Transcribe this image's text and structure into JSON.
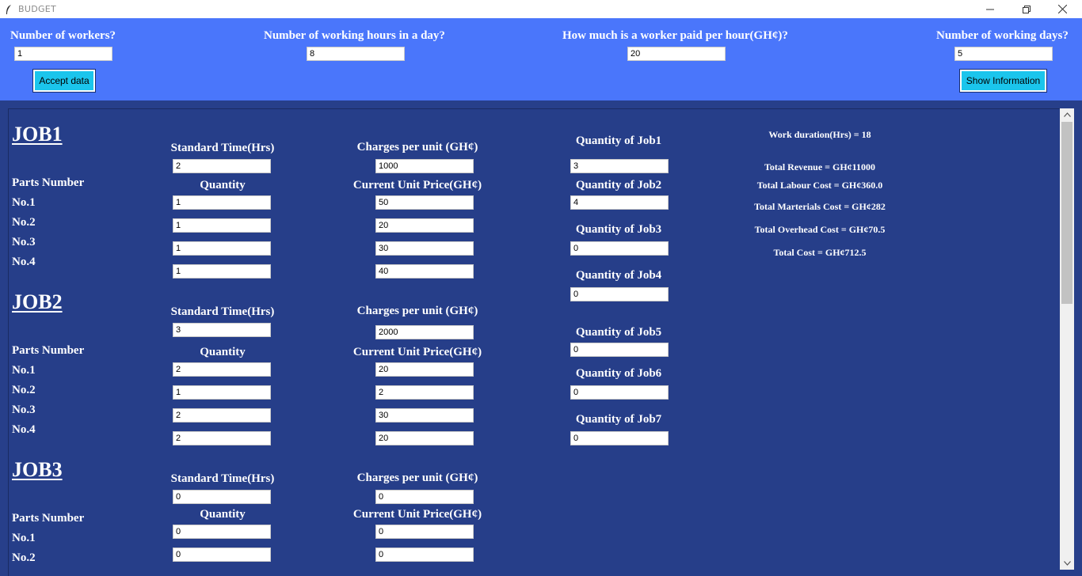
{
  "window": {
    "title": "BUDGET"
  },
  "top": {
    "workers_label": "Number of workers?",
    "workers_value": "1",
    "hours_label": "Number of working hours in a day?",
    "hours_value": "8",
    "pay_label": "How much is a worker paid per hour(GH¢)?",
    "pay_value": "20",
    "days_label": "Number of working days?",
    "days_value": "5",
    "accept_button": "Accept data",
    "show_button": "Show Information"
  },
  "labels": {
    "standard_time": "Standard Time(Hrs)",
    "charges": "Charges per unit (GH¢)",
    "parts_number": "Parts Number",
    "quantity": "Quantity",
    "unit_price": "Current Unit Price(GH¢)",
    "no1": "No.1",
    "no2": "No.2",
    "no3": "No.3",
    "no4": "No.4"
  },
  "jobs": [
    {
      "title": "JOB1",
      "standard_time": "2",
      "charges": "1000",
      "quantities": [
        "1",
        "1",
        "1",
        "1"
      ],
      "prices": [
        "50",
        "20",
        "30",
        "40"
      ]
    },
    {
      "title": "JOB2",
      "standard_time": "3",
      "charges": "2000",
      "quantities": [
        "2",
        "1",
        "2",
        "2"
      ],
      "prices": [
        "20",
        "2",
        "30",
        "20"
      ]
    },
    {
      "title": "JOB3",
      "standard_time": "0",
      "charges": "0",
      "quantities": [
        "0",
        "0"
      ],
      "prices": [
        "0",
        "0"
      ]
    }
  ],
  "job_quantities": [
    {
      "label": "Quantity of Job1",
      "value": "3"
    },
    {
      "label": "Quantity of Job2",
      "value": "4"
    },
    {
      "label": "Quantity of Job3",
      "value": "0"
    },
    {
      "label": "Quantity of Job4",
      "value": "0"
    },
    {
      "label": "Quantity of Job5",
      "value": "0"
    },
    {
      "label": "Quantity of Job6",
      "value": "0"
    },
    {
      "label": "Quantity of Job7",
      "value": "0"
    }
  ],
  "summary": {
    "work_duration": "Work duration(Hrs) = 18",
    "total_revenue": "Total Revenue = GH¢11000",
    "total_labour": "Total Labour Cost = GH¢360.0",
    "total_materials": "Total Marterials Cost = GH¢282",
    "total_overhead": "Total Overhead Cost = GH¢70.5",
    "total_cost": "Total Cost = GH¢712.5"
  }
}
